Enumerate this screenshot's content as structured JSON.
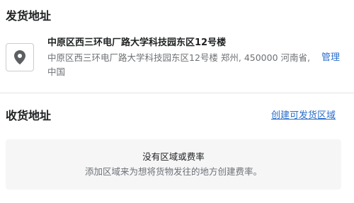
{
  "origin": {
    "title": "发货地址",
    "icon": "location-pin-icon",
    "address_name": "中原区西三环电厂路大学科技园东区12号楼",
    "address_detail": "中原区西三环电厂路大学科技园东区12号楼 郑州, 450000 河南省, 中国",
    "manage_label": "管理"
  },
  "destinations": {
    "title": "收货地址",
    "create_label": "创建可发货区域",
    "empty_title": "没有区域或费率",
    "empty_description": "添加区域来为想将货物发往的地方创建费率。"
  },
  "colors": {
    "link": "#2c6ecb",
    "muted_text": "#6d7175",
    "empty_background": "#f6f6f7"
  }
}
